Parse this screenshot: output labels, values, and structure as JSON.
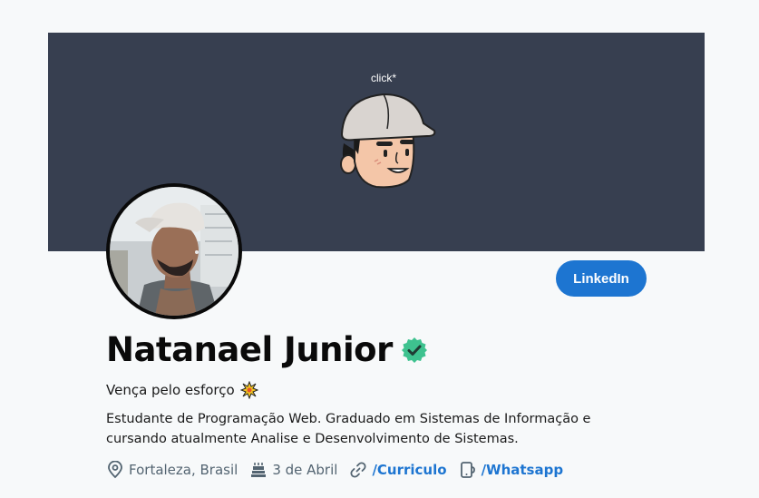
{
  "banner": {
    "click_label": "click*",
    "bg_color": "#373f50",
    "illustration_icon": "cartoon-face-cap"
  },
  "profile": {
    "name": "Natanael Junior",
    "verified_icon": "verified-badge-icon",
    "verified_color": "#3ec28f",
    "tagline": "Vença pelo esforço",
    "tagline_emoji_icon": "sparkle-burst-icon",
    "bio": "Estudante de Programação Web. Graduado em Sistemas de Informação e cursando atualmente Analise e Desenvolvimento de Sistemas."
  },
  "actions": {
    "linkedin_label": "LinkedIn",
    "accent_color": "#1d75d1"
  },
  "meta": {
    "location": "Fortaleza, Brasil",
    "birthday": "3 de Abril",
    "curriculo_link": "/Curriculo",
    "whatsapp_link": "/Whatsapp"
  }
}
